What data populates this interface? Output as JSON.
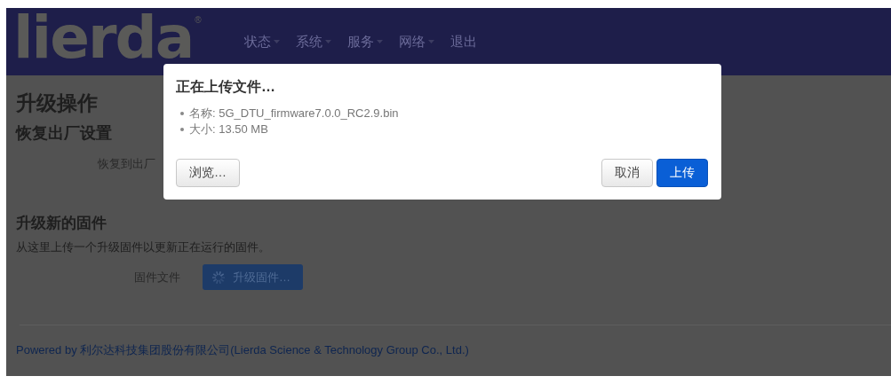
{
  "header": {
    "logo": "lierda",
    "registered_mark": "®",
    "nav": [
      {
        "label": "状态",
        "has_menu": true
      },
      {
        "label": "系统",
        "has_menu": true
      },
      {
        "label": "服务",
        "has_menu": true
      },
      {
        "label": "网络",
        "has_menu": true
      },
      {
        "label": "退出",
        "has_menu": false
      }
    ]
  },
  "page": {
    "title": "升级操作",
    "reset": {
      "heading": "恢复出厂设置",
      "label": "恢复到出厂"
    },
    "firmware": {
      "heading": "升级新的固件",
      "description": "从这里上传一个升级固件以更新正在运行的固件。",
      "field_label": "固件文件",
      "button": "升级固件…",
      "busy": true
    }
  },
  "footer": {
    "link": "Powered by 利尔达科技集团股份有限公司(Lierda Science & Technology Group Co., Ltd.)"
  },
  "dialog": {
    "title": "正在上传文件…",
    "details": [
      "名称: 5G_DTU_firmware7.0.0_RC2.9.bin",
      "大小: 13.50 MB"
    ],
    "buttons": [
      {
        "label": "浏览…",
        "kind": "default"
      },
      {
        "label": "取消",
        "kind": "default"
      },
      {
        "label": "上传",
        "kind": "primary"
      }
    ]
  }
}
